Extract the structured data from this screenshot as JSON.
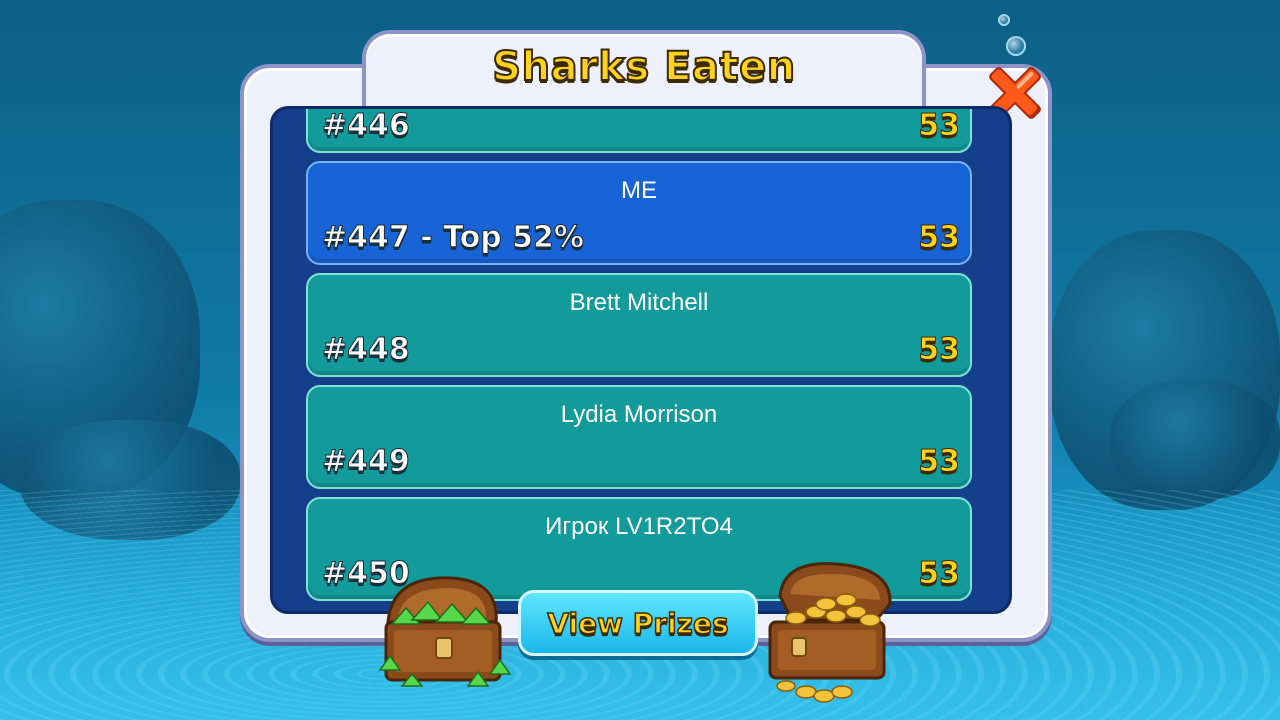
{
  "title": "Sharks Eaten",
  "leaderboard": {
    "rows": [
      {
        "name": "",
        "rank": "#446",
        "score": "53",
        "is_me": false
      },
      {
        "name": "ME",
        "rank": "#447 - Top 52%",
        "score": "53",
        "is_me": true
      },
      {
        "name": "Brett Mitchell",
        "rank": "#448",
        "score": "53",
        "is_me": false
      },
      {
        "name": "Lydia Morrison",
        "rank": "#449",
        "score": "53",
        "is_me": false
      },
      {
        "name": "Игрок LV1R2TO4",
        "rank": "#450",
        "score": "53",
        "is_me": false
      }
    ]
  },
  "buttons": {
    "view_prizes": "View Prizes",
    "close_icon": "close-x-icon"
  },
  "decor": {
    "left_chest": "gem-treasure-chest-icon",
    "right_chest": "gold-coin-treasure-chest-icon"
  },
  "colors": {
    "title_yellow": "#ffd21c",
    "row_teal": "#139b9c",
    "row_me_blue": "#1863d6",
    "list_bg": "#163f8b",
    "close_orange": "#ff5a1a"
  }
}
